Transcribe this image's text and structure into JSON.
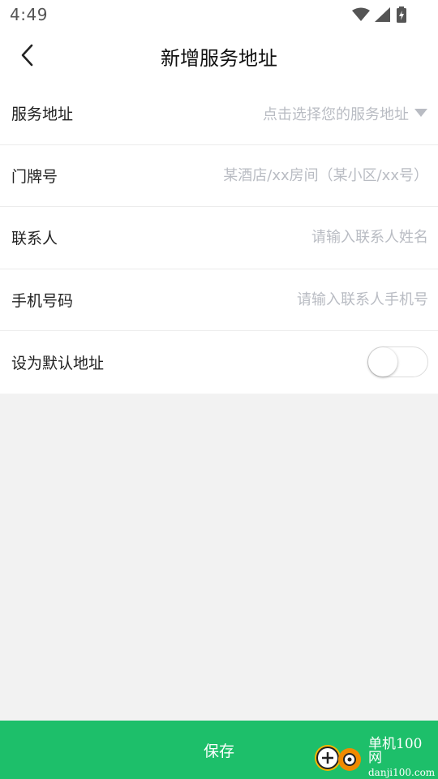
{
  "status_bar": {
    "time": "4:49",
    "icons": [
      "wifi-icon",
      "signal-icon",
      "battery-charging-icon"
    ]
  },
  "header": {
    "title": "新增服务地址",
    "back_icon": "chevron-left-icon"
  },
  "form": {
    "service_address": {
      "label": "服务地址",
      "placeholder": "点击选择您的服务地址",
      "icon": "caret-down-icon"
    },
    "door_number": {
      "label": "门牌号",
      "placeholder": "某酒店/xx房间（某小区/xx号）"
    },
    "contact_name": {
      "label": "联系人",
      "placeholder": "请输入联系人姓名"
    },
    "phone": {
      "label": "手机号码",
      "placeholder": "请输入联系人手机号"
    },
    "default_address": {
      "label": "设为默认地址",
      "enabled": false
    }
  },
  "footer": {
    "save_label": "保存"
  },
  "watermark": {
    "brand": "单机100网",
    "domain": "danji100.com"
  },
  "colors": {
    "accent": "#1dbf6a",
    "placeholder": "#b9bcc3",
    "background": "#f2f2f2"
  }
}
